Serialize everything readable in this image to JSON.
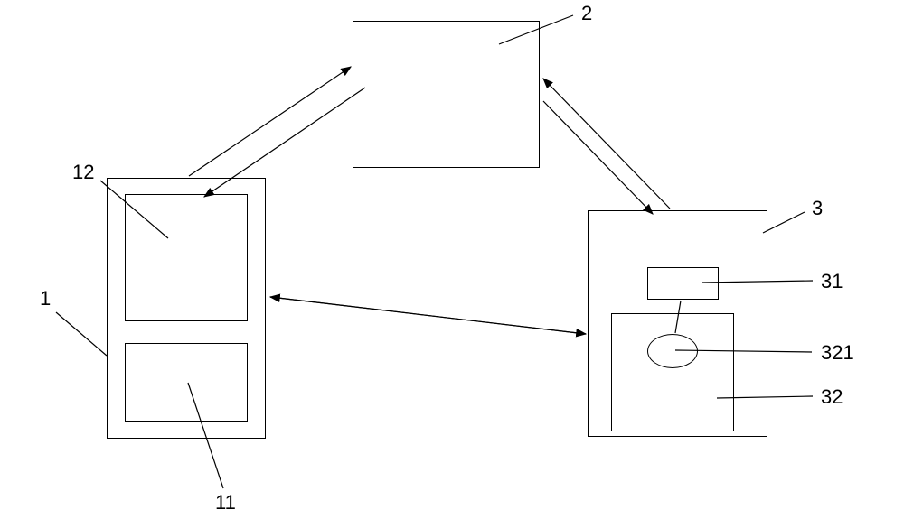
{
  "labels": {
    "box1": "1",
    "box2": "2",
    "box3": "3",
    "box11": "11",
    "box12": "12",
    "box31": "31",
    "box32": "32",
    "ellipse321": "321"
  }
}
